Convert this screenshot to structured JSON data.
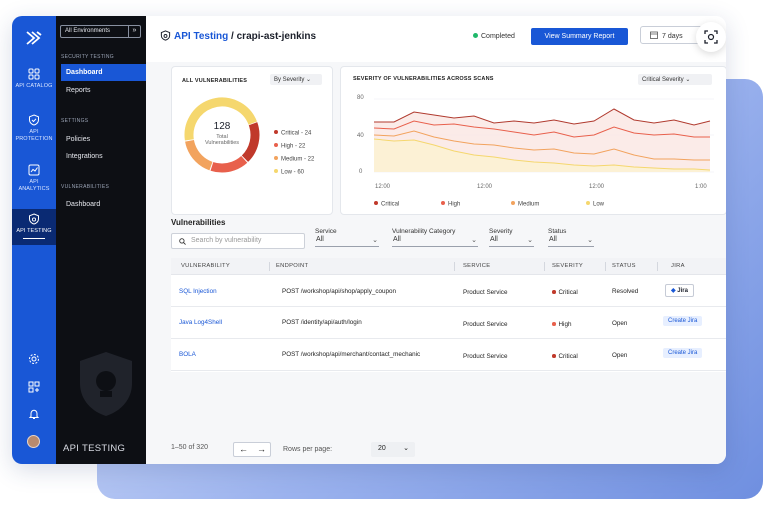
{
  "rail": {
    "items": [
      {
        "label_1": "API CATALOG",
        "label_2": ""
      },
      {
        "label_1": "API",
        "label_2": "PROTECTION"
      },
      {
        "label_1": "API",
        "label_2": "ANALYTICS"
      },
      {
        "label_1": "API TESTING",
        "label_2": ""
      }
    ]
  },
  "nav": {
    "environment": "All Environments",
    "section_security_testing": "SECURITY TESTING",
    "dashboard": "Dashboard",
    "reports": "Reports",
    "section_settings": "SETTINGS",
    "policies": "Policies",
    "integrations": "Integrations",
    "section_vulnerabilities": "VULNERABILITIES",
    "vuln_dashboard": "Dashboard",
    "footer_title": "API TESTING"
  },
  "header": {
    "title_prefix": "API Testing",
    "title_separator": " / ",
    "title_project": "crapi-ast-jenkins",
    "status": "Completed",
    "primary_button": "View Summary Report",
    "date_range": "7 days"
  },
  "donut": {
    "title": "ALL VULNERABILITIES",
    "group_by": "By Severity",
    "total": "128",
    "total_label_1": "Total",
    "total_label_2": "Vulnerabilities",
    "legend": [
      {
        "label": "Critical - 24",
        "color": "#c0392b",
        "value": 24
      },
      {
        "label": "High - 22",
        "color": "#e8604c",
        "value": 22
      },
      {
        "label": "Medium - 22",
        "color": "#f2a35e",
        "value": 22
      },
      {
        "label": "Low - 60",
        "color": "#f5d76e",
        "value": 60
      }
    ]
  },
  "trend": {
    "title": "SEVERITY OF VULNERABILITIES ACROSS SCANS",
    "filter": "Critical Severity",
    "yticks": [
      "80",
      "40",
      "0"
    ],
    "xticks": [
      "12:00",
      "12:00",
      "12:00",
      "1:00"
    ],
    "legend": [
      {
        "label": "Critical",
        "color": "#c0392b"
      },
      {
        "label": "High",
        "color": "#e8604c"
      },
      {
        "label": "Medium",
        "color": "#f2a35e"
      },
      {
        "label": "Low",
        "color": "#f5d76e"
      }
    ]
  },
  "vulns": {
    "section_title": "Vulnerabilities",
    "search_placeholder": "Search by vulnerability",
    "filters": [
      {
        "label": "Service",
        "value": "All"
      },
      {
        "label": "Vulnerability Category",
        "value": "All"
      },
      {
        "label": "Severity",
        "value": "All"
      },
      {
        "label": "Status",
        "value": "All"
      }
    ],
    "columns": [
      "VULNERABILITY",
      "ENDPOINT",
      "SERVICE",
      "SEVERITY",
      "STATUS",
      "JIRA"
    ],
    "rows": [
      {
        "name": "SQL Injection",
        "endpoint": "POST /workshop/api/shop/apply_coupon",
        "service": "Product Service",
        "severity": "Critical",
        "severity_color": "#c0392b",
        "status": "Resolved",
        "jira": "Jira"
      },
      {
        "name": "Java Log4Shell",
        "endpoint": "POST /identity/api/auth/login",
        "service": "Product Service",
        "severity": "High",
        "severity_color": "#e8604c",
        "status": "Open",
        "jira": "Create Jira"
      },
      {
        "name": "BOLA",
        "endpoint": "POST /workshop/api/merchant/contact_mechanic",
        "service": "Product Service",
        "severity": "Critical",
        "severity_color": "#c0392b",
        "status": "Open",
        "jira": "Create Jira"
      }
    ],
    "range_text": "1–50 of 320",
    "rows_per_page_label": "Rows per page:",
    "rows_per_page": "20"
  }
}
